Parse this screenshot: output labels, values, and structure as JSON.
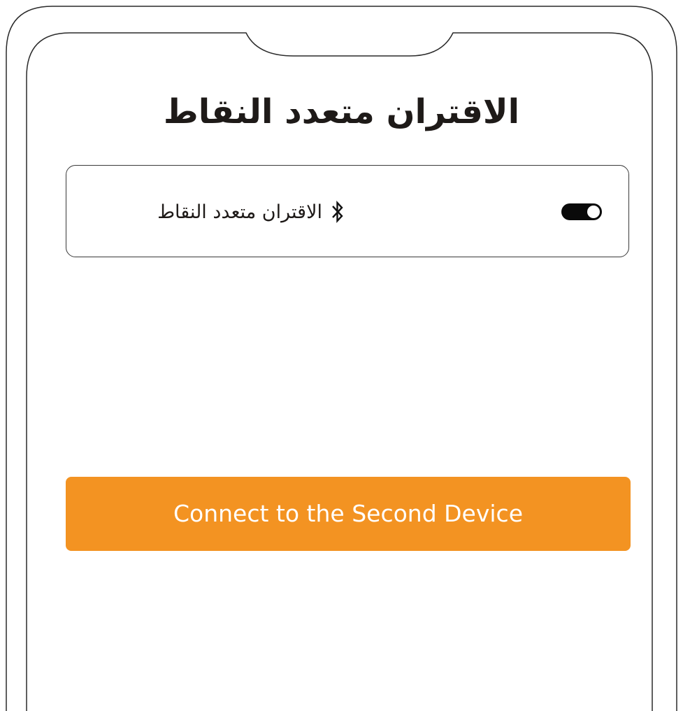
{
  "screen": {
    "title": "الاقتران متعدد النقاط"
  },
  "setting": {
    "label": "الاقتران متعدد النقاط",
    "icon": "bluetooth-icon",
    "toggle_state": "on"
  },
  "actions": {
    "connect_label": "Connect to the Second Device",
    "accent_color": "#f39322"
  }
}
